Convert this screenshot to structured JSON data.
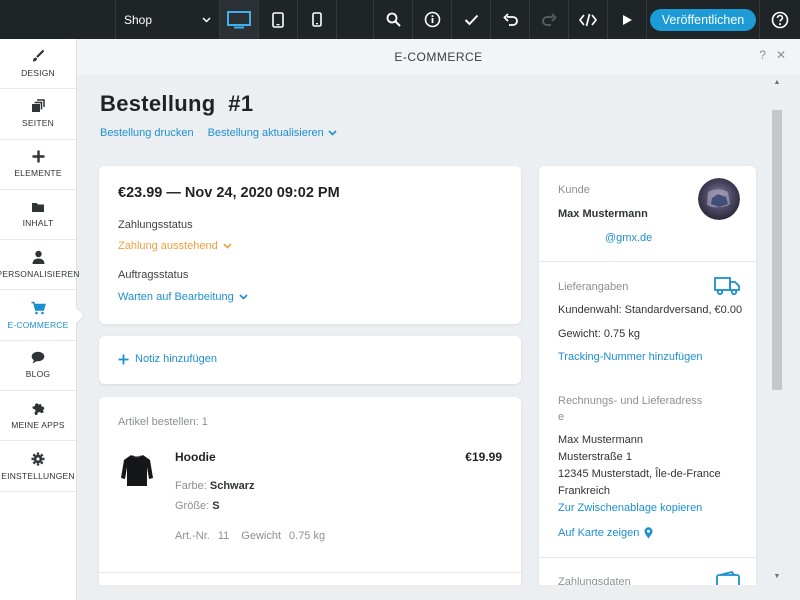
{
  "topbar": {
    "site_select": "Shop",
    "publish_label": "Veröffentlichen",
    "icons": [
      "desktop-icon",
      "tablet-icon",
      "mobile-icon",
      "search-icon",
      "info-icon",
      "check-icon",
      "undo-icon",
      "redo-icon",
      "code-icon",
      "play-icon",
      "help-icon"
    ]
  },
  "sidebar": {
    "items": [
      {
        "label": "DESIGN",
        "icon": "brush-icon"
      },
      {
        "label": "SEITEN",
        "icon": "pages-icon"
      },
      {
        "label": "ELEMENTE",
        "icon": "plus-icon"
      },
      {
        "label": "INHALT",
        "icon": "folder-icon"
      },
      {
        "label": "PERSONALISIEREN",
        "icon": "person-icon"
      },
      {
        "label": "E-COMMERCE",
        "icon": "cart-icon",
        "active": true
      },
      {
        "label": "BLOG",
        "icon": "chat-bubble-icon"
      },
      {
        "label": "MEINE APPS",
        "icon": "puzzle-icon"
      },
      {
        "label": "EINSTELLUNGEN",
        "icon": "gear-icon"
      }
    ]
  },
  "panel": {
    "title": "E-COMMERCE",
    "help": "?",
    "close": "✕"
  },
  "order": {
    "title": "Bestellung  #1",
    "print_link": "Bestellung drucken",
    "update_link": "Bestellung aktualisieren",
    "price_date": "€23.99 — Nov 24, 2020 09:02 PM",
    "payment_label": "Zahlungsstatus",
    "payment_status": "Zahlung ausstehend",
    "order_label": "Auftragsstatus",
    "order_status": "Warten auf Bearbeitung",
    "add_note": "Notiz hinzufügen"
  },
  "items": {
    "header": "Artikel bestellen: 1",
    "list": [
      {
        "name": "Hoodie",
        "price": "€19.99",
        "color_label": "Farbe:",
        "color_value": "Schwarz",
        "size_label": "Größe:",
        "size_value": "S",
        "sku_label": "Art.-Nr.",
        "sku_value": "11",
        "weight_label": "Gewicht",
        "weight_value": "0.75 kg"
      }
    ]
  },
  "customer": {
    "section_title": "Kunde",
    "name": "Max Mustermann",
    "email": "@gmx.de"
  },
  "shipping": {
    "section_title": "Lieferangaben",
    "method": "Kundenwahl: Standardversand, €0.00",
    "weight": "Gewicht: 0.75 kg",
    "tracking_link": "Tracking-Nummer hinzufügen"
  },
  "address": {
    "section_title_line1": "Rechnungs- und Lieferadress",
    "section_title_line2": "e",
    "name": "Max Mustermann",
    "street": "Musterstraße 1",
    "city": "12345 Musterstadt, Île-de-France",
    "country": "Frankreich",
    "copy_link": "Zur Zwischenablage kopieren",
    "map_link": "Auf Karte zeigen"
  },
  "payment": {
    "section_title": "Zahlungsdaten"
  },
  "colors": {
    "accent": "#1d8fd0",
    "publish": "#1d9bd6",
    "pending": "#f0a03c",
    "topbar": "#1f2426"
  }
}
